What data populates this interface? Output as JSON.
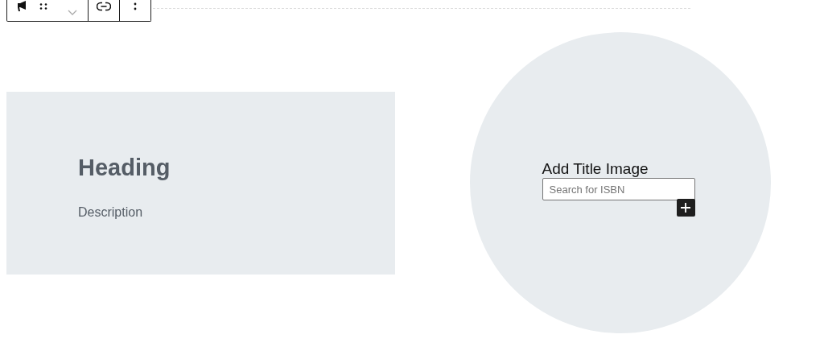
{
  "card": {
    "heading": "Heading",
    "description": "Description"
  },
  "title_image": {
    "label": "Add Title Image",
    "search": {
      "placeholder": "Search for ISBN"
    }
  }
}
